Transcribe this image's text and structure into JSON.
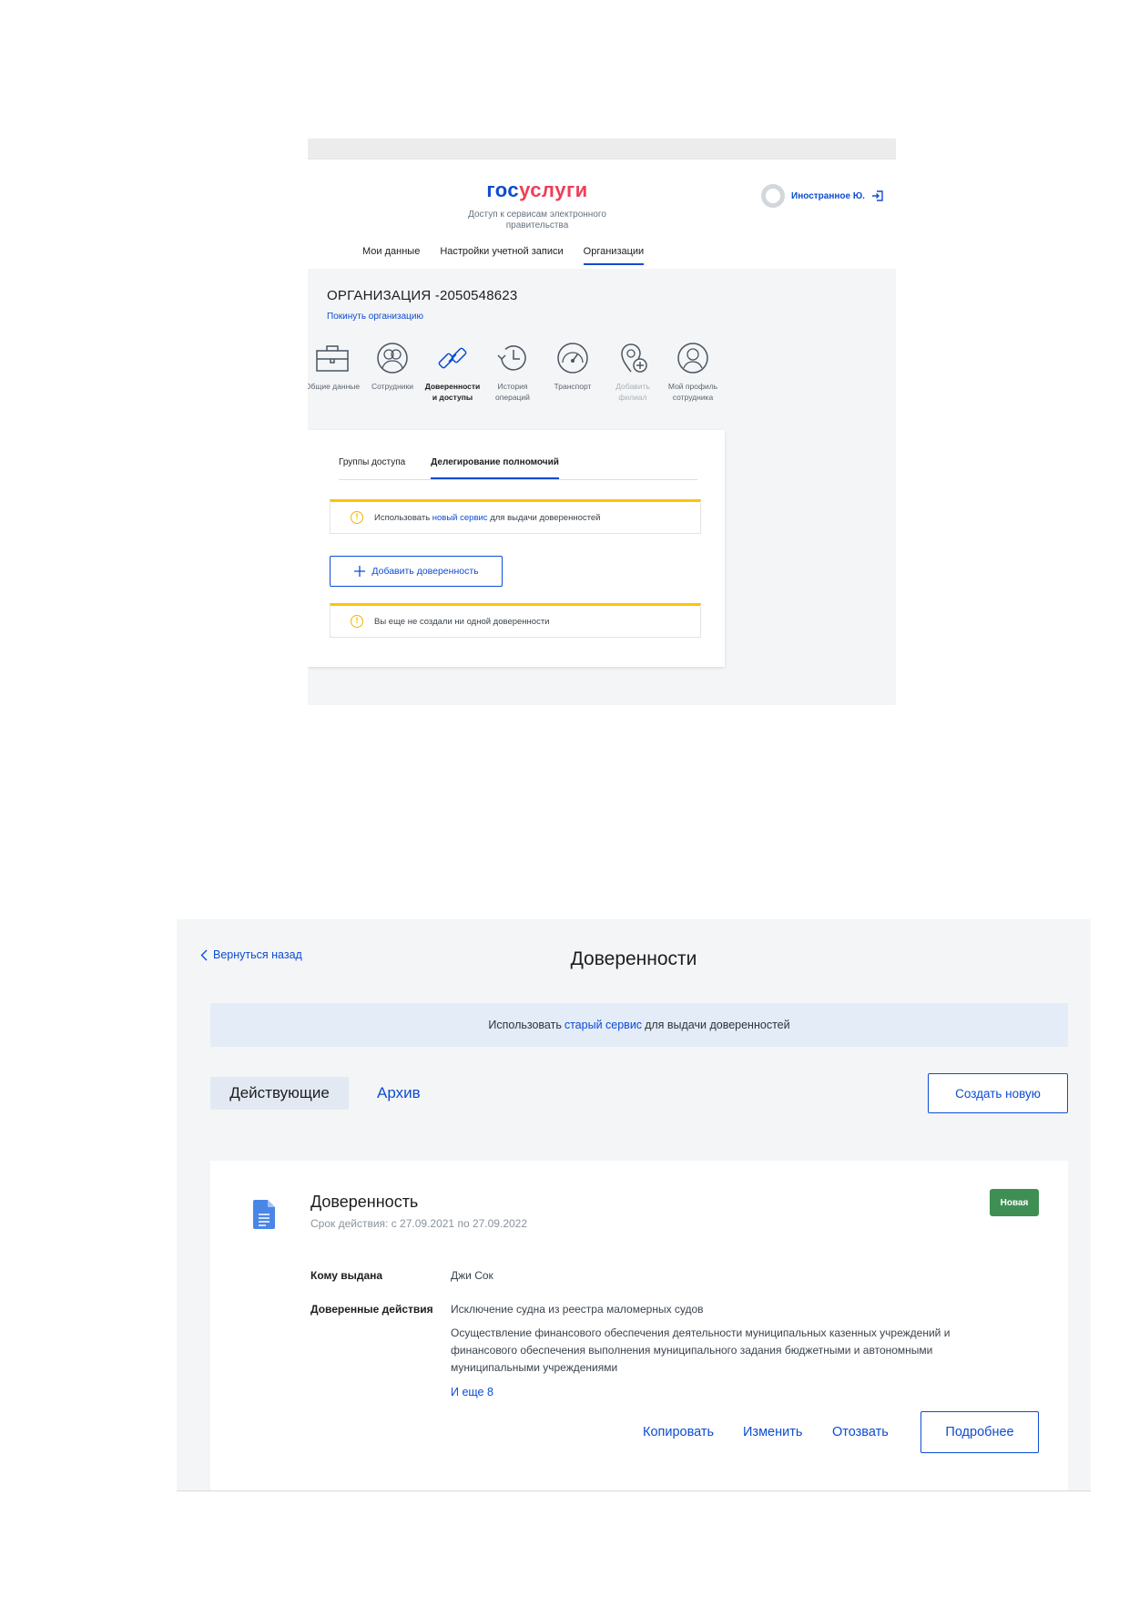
{
  "legacy": {
    "logo": {
      "gos": "гос",
      "uslugi": "услуги"
    },
    "logo_subtitle": "Доступ к сервисам электронного правительства",
    "user_name": "Иностранное Ю.",
    "nav": [
      "Мои данные",
      "Настройки учетной записи",
      "Организации"
    ],
    "org_title": "ОРГАНИЗАЦИЯ -2050548623",
    "org_leave": "Покинуть организацию",
    "sections": [
      {
        "label": "Общие данные",
        "icon": "briefcase-icon"
      },
      {
        "label": "Сотрудники",
        "icon": "employees-icon"
      },
      {
        "label": "Доверенности и доступы",
        "icon": "link-icon"
      },
      {
        "label": "История операций",
        "icon": "history-icon"
      },
      {
        "label": "Транспорт",
        "icon": "speedometer-icon"
      },
      {
        "label": "Добавить филиал",
        "icon": "add-location-icon"
      },
      {
        "label": "Мой профиль сотрудника",
        "icon": "profile-icon"
      }
    ],
    "subtabs": [
      "Группы доступа",
      "Делегирование полномочий"
    ],
    "alert_use_new": {
      "before": "Использовать",
      "link": "новый сервис",
      "after": "для выдачи доверенностей"
    },
    "add_button": "Добавить доверенность",
    "alert_none": "Вы еще не создали ни одной доверенности"
  },
  "new_service": {
    "back": "Вернуться назад",
    "title": "Доверенности",
    "banner": {
      "before": "Использовать",
      "link": "старый сервис",
      "after": "для выдачи доверенностей"
    },
    "tabs": [
      "Действующие",
      "Архив"
    ],
    "create_button": "Создать новую",
    "card": {
      "title": "Доверенность",
      "term": "Срок действия: с 27.09.2021 по 27.09.2022",
      "badge": "Новая",
      "issued_to_label": "Кому выдана",
      "issued_to": "Джи Сок",
      "actions_label": "Доверенные действия",
      "actions": [
        "Исключение судна из реестра маломерных судов",
        "Осуществление финансового обеспечения деятельности муниципальных казенных учреждений и финансового обеспечения выполнения муниципального задания бюджетными и автономными муниципальными учреждениями"
      ],
      "more": "И еще 8",
      "buttons": {
        "copy": "Копировать",
        "edit": "Изменить",
        "revoke": "Отозвать",
        "details": "Подробнее"
      }
    }
  }
}
